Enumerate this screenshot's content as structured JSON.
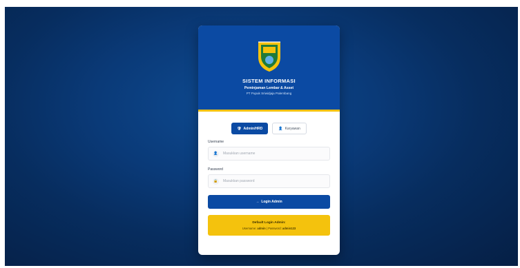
{
  "header": {
    "title": "SISTEM INFORMASI",
    "subtitle": "Peminjaman Lembar & Asset",
    "org": "PT Pupuk Sriwidjaja Palembang",
    "colors": {
      "brand": "#0b4aa3",
      "accent": "#f4c20d"
    }
  },
  "tabs": [
    {
      "label": "Admin/HRD",
      "icon": "shield-icon",
      "active": true
    },
    {
      "label": "Karyawan",
      "icon": "user-icon",
      "active": false
    }
  ],
  "form": {
    "username_label": "Username",
    "username_placeholder": "Masukkan username",
    "password_label": "Password",
    "password_placeholder": "Masukkan password",
    "login_button": "Login Admin"
  },
  "info": {
    "title": "Default Login Admin:",
    "username_label": "Username:",
    "username_value": "admin",
    "separator": "|",
    "password_label": "Password:",
    "password_value": "admin123"
  }
}
